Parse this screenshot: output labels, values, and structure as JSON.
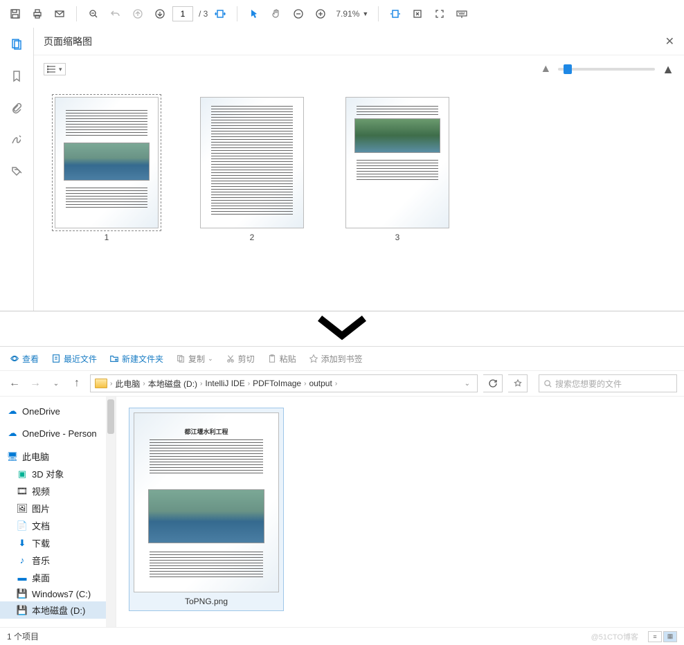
{
  "pdf": {
    "toolbar": {
      "page_current": "1",
      "page_total": "/ 3",
      "zoom_value": "7.91%"
    },
    "panel_title": "页面缩略图",
    "thumbnails": [
      {
        "num": "1",
        "selected": true
      },
      {
        "num": "2",
        "selected": false
      },
      {
        "num": "3",
        "selected": false
      }
    ]
  },
  "explorer": {
    "ribbon": {
      "view": "查看",
      "recent": "最近文件",
      "new_folder": "新建文件夹",
      "copy": "复制",
      "cut": "剪切",
      "paste": "粘贴",
      "bookmark": "添加到书签"
    },
    "breadcrumb": [
      "此电脑",
      "本地磁盘 (D:)",
      "IntelliJ IDE",
      "PDFToImage",
      "output"
    ],
    "search_placeholder": "搜索您想要的文件",
    "tree": [
      {
        "icon": "cloud-blue",
        "label": "OneDrive"
      },
      {
        "icon": "cloud-blue",
        "label": "OneDrive - Person"
      },
      {
        "icon": "monitor",
        "label": "此电脑"
      },
      {
        "icon": "cube-teal",
        "label": "3D 对象",
        "indent": true
      },
      {
        "icon": "film",
        "label": "视频",
        "indent": true
      },
      {
        "icon": "picture",
        "label": "图片",
        "indent": true
      },
      {
        "icon": "doc",
        "label": "文档",
        "indent": true
      },
      {
        "icon": "download-blue",
        "label": "下载",
        "indent": true
      },
      {
        "icon": "music-blue",
        "label": "音乐",
        "indent": true
      },
      {
        "icon": "desktop",
        "label": "桌面",
        "indent": true
      },
      {
        "icon": "drive",
        "label": "Windows7 (C:)",
        "indent": true
      },
      {
        "icon": "drive",
        "label": "本地磁盘 (D:)",
        "indent": true,
        "selected": true
      }
    ],
    "files": [
      {
        "name": "ToPNG.png"
      }
    ],
    "status": "1 个项目",
    "watermark": "@51CTO博客"
  }
}
